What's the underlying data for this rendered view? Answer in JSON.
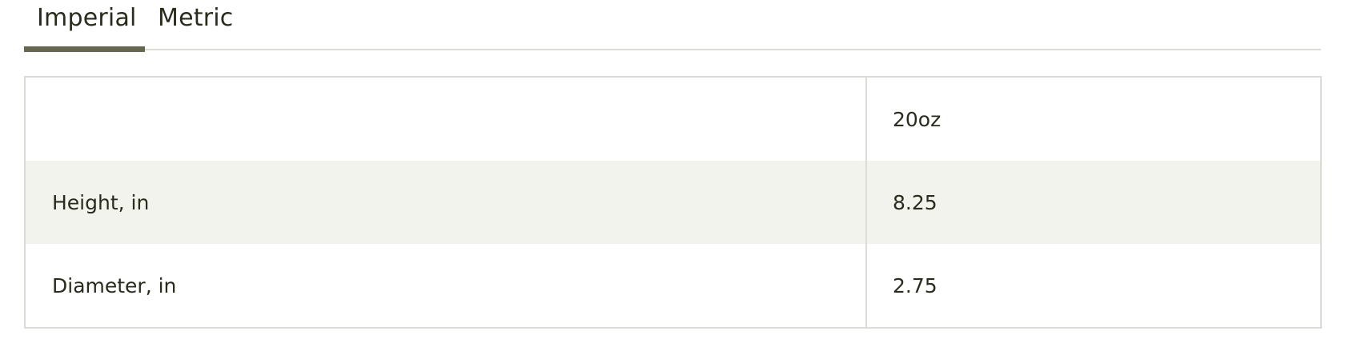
{
  "tabs": [
    {
      "label": "Imperial",
      "active": true
    },
    {
      "label": "Metric",
      "active": false
    }
  ],
  "table": {
    "header": {
      "label": "",
      "value": "20oz"
    },
    "rows": [
      {
        "label": "Height, in",
        "value": "8.25"
      },
      {
        "label": "Diameter, in",
        "value": "2.75"
      }
    ]
  },
  "colors": {
    "active_tab_indicator": "#66674f",
    "row_shade": "#f3f3ee",
    "border": "#dcdcd6",
    "text": "#2a2b1c"
  }
}
